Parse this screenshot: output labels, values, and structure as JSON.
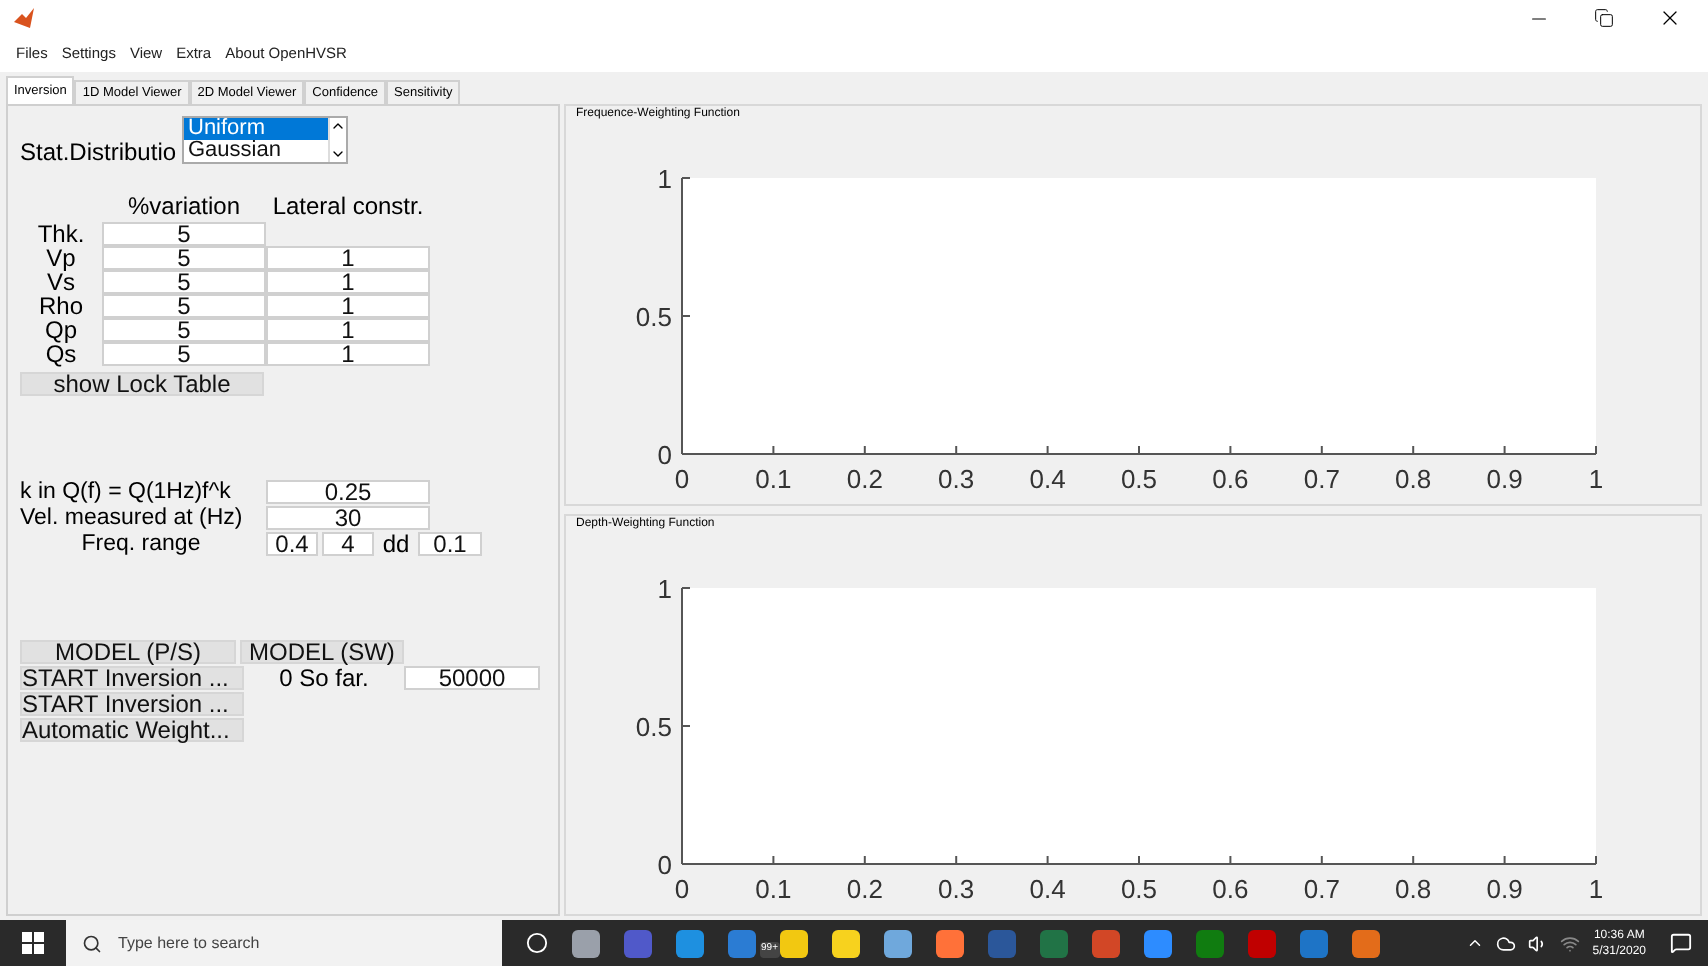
{
  "menu": [
    {
      "label": "Files"
    },
    {
      "label": "Settings"
    },
    {
      "label": "View"
    },
    {
      "label": "Extra"
    },
    {
      "label": "About OpenHVSR"
    }
  ],
  "tabs": [
    {
      "label": "Inversion",
      "selected": true
    },
    {
      "label": "1D Model Viewer",
      "selected": false
    },
    {
      "label": "2D Model Viewer",
      "selected": false
    },
    {
      "label": "Confidence",
      "selected": false
    },
    {
      "label": "Sensitivity",
      "selected": false
    }
  ],
  "distribution": {
    "label": "Stat.Distributio",
    "options": [
      {
        "label": "Uniform",
        "selected": true
      },
      {
        "label": "Gaussian",
        "selected": false
      }
    ]
  },
  "variation_table": {
    "columns": [
      "%variation",
      "Lateral constr."
    ],
    "rows": [
      {
        "label": "Thk.",
        "variation": "5"
      },
      {
        "label": "Vp",
        "variation": "5",
        "lateral": "1"
      },
      {
        "label": "Vs",
        "variation": "5",
        "lateral": "1"
      },
      {
        "label": "Rho",
        "variation": "5",
        "lateral": "1"
      },
      {
        "label": "Qp",
        "variation": "5",
        "lateral": "1"
      },
      {
        "label": "Qs",
        "variation": "5",
        "lateral": "1"
      }
    ]
  },
  "lock_button": "show Lock Table",
  "k_field": {
    "label": "k in Q(f) = Q(1Hz)f^k",
    "value": "0.25"
  },
  "vel_field": {
    "label": "Vel. measured at (Hz)",
    "value": "30"
  },
  "freq_range": {
    "label": "Freq. range",
    "min": "0.4",
    "max": "4",
    "dd_label": "dd",
    "dd": "0.1"
  },
  "model_buttons": [
    "MODEL (P/S)",
    "MODEL (SW)"
  ],
  "start_buttons": [
    "START Inversion ...",
    "START Inversion ..."
  ],
  "so_far": "0 So far.",
  "iterations": "50000",
  "auto_weight_button": "Automatic Weight...",
  "panels": [
    {
      "title": "Frequence-Weighting Function",
      "chart_data": {
        "type": "line",
        "xlim": [
          0,
          1
        ],
        "ylim": [
          0,
          1
        ],
        "xticks": [
          {
            "value": 0,
            "label": "0"
          },
          {
            "value": 0.1,
            "label": "0.1"
          },
          {
            "value": 0.2,
            "label": "0.2"
          },
          {
            "value": 0.3,
            "label": "0.3"
          },
          {
            "value": 0.4,
            "label": "0.4"
          },
          {
            "value": 0.5,
            "label": "0.5"
          },
          {
            "value": 0.6,
            "label": "0.6"
          },
          {
            "value": 0.7,
            "label": "0.7"
          },
          {
            "value": 0.8,
            "label": "0.8"
          },
          {
            "value": 0.9,
            "label": "0.9"
          },
          {
            "value": 1,
            "label": "1"
          }
        ],
        "yticks": [
          {
            "value": 0,
            "label": "0"
          },
          {
            "value": 0.5,
            "label": "0.5"
          },
          {
            "value": 1,
            "label": "1"
          }
        ]
      }
    },
    {
      "title": "Depth-Weighting Function",
      "chart_data": {
        "type": "line",
        "xlim": [
          0,
          1
        ],
        "ylim": [
          0,
          1
        ],
        "xticks": [
          {
            "value": 0,
            "label": "0"
          },
          {
            "value": 0.1,
            "label": "0.1"
          },
          {
            "value": 0.2,
            "label": "0.2"
          },
          {
            "value": 0.3,
            "label": "0.3"
          },
          {
            "value": 0.4,
            "label": "0.4"
          },
          {
            "value": 0.5,
            "label": "0.5"
          },
          {
            "value": 0.6,
            "label": "0.6"
          },
          {
            "value": 0.7,
            "label": "0.7"
          },
          {
            "value": 0.8,
            "label": "0.8"
          },
          {
            "value": 0.9,
            "label": "0.9"
          },
          {
            "value": 1,
            "label": "1"
          }
        ],
        "yticks": [
          {
            "value": 0,
            "label": "0"
          },
          {
            "value": 0.5,
            "label": "0.5"
          },
          {
            "value": 1,
            "label": "1"
          }
        ]
      }
    }
  ],
  "taskbar": {
    "search_placeholder": "Type here to search",
    "badge": "99+",
    "time": "10:36 AM",
    "date": "5/31/2020"
  }
}
